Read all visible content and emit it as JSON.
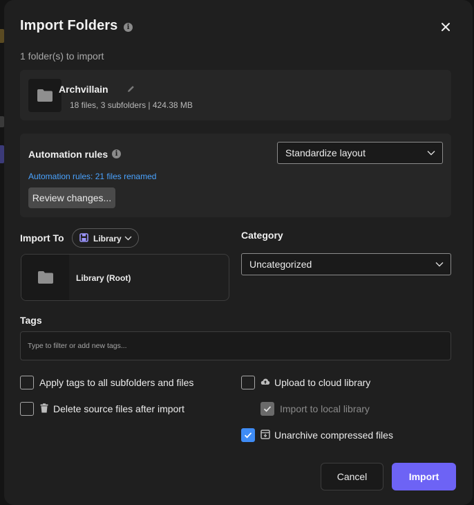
{
  "dialog": {
    "title": "Import Folders",
    "subtitle": "1 folder(s) to import"
  },
  "folder": {
    "name": "Archvillain",
    "meta": "18 files, 3 subfolders  | 424.38 MB"
  },
  "automation": {
    "title": "Automation rules",
    "link": "Automation rules: 21 files renamed",
    "review_button": "Review changes...",
    "layout_select": "Standardize layout"
  },
  "import_to": {
    "label": "Import To",
    "location": "Library",
    "destination": "Library (Root)"
  },
  "category": {
    "label": "Category",
    "value": "Uncategorized"
  },
  "tags": {
    "label": "Tags",
    "placeholder": "Type to filter or add new tags..."
  },
  "options": {
    "apply_tags": {
      "label": "Apply tags to all subfolders and files",
      "checked": false
    },
    "delete_source": {
      "label": "Delete source files after import",
      "checked": false,
      "icon": "trash-icon"
    },
    "upload_cloud": {
      "label": "Upload to cloud library",
      "checked": false,
      "icon": "cloud-upload-icon"
    },
    "import_local": {
      "label": "Import to local library",
      "checked": true,
      "disabled": true
    },
    "unarchive": {
      "label": "Unarchive compressed files",
      "checked": true,
      "icon": "archive-icon"
    }
  },
  "footer": {
    "cancel": "Cancel",
    "import": "Import"
  },
  "colors": {
    "accent": "#6d63f5",
    "link": "#4aa3ff",
    "checkbox": "#3f8cf5",
    "dialog_bg": "#1f1f1f"
  }
}
